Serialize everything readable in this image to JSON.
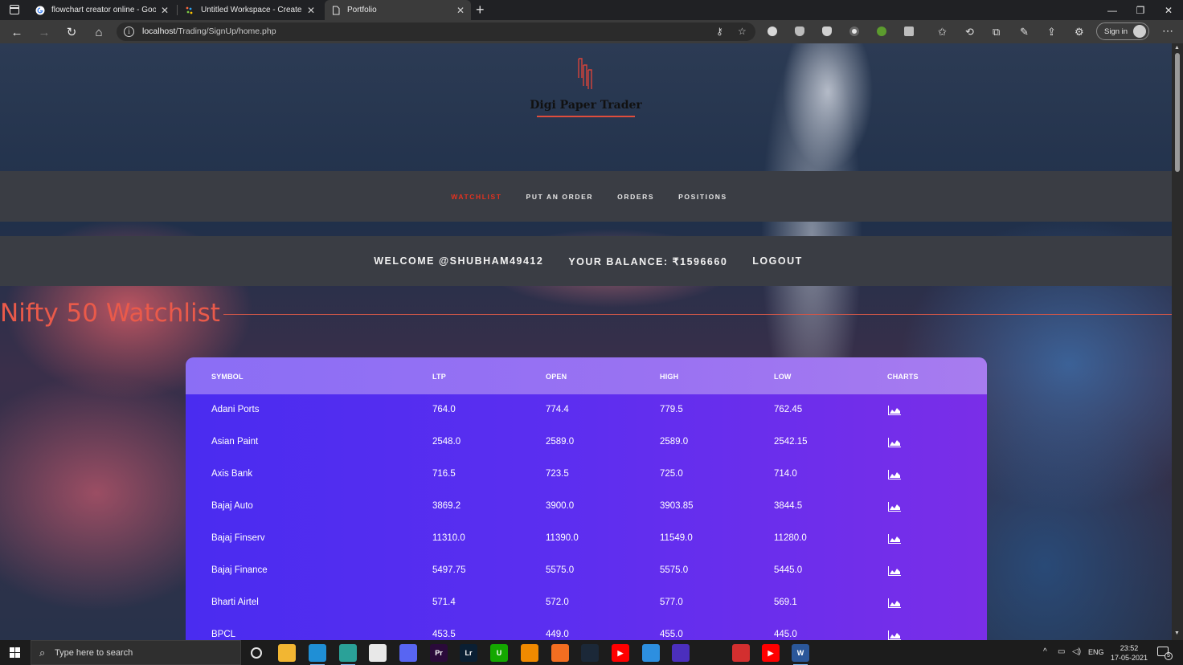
{
  "browser": {
    "tabs": [
      {
        "label": "flowchart creator online - Googl",
        "favicon": "google-icon"
      },
      {
        "label": "Untitled Workspace - Creately",
        "favicon": "creately-icon"
      },
      {
        "label": "Portfolio",
        "favicon": "page-icon",
        "active": true
      }
    ],
    "window_controls": {
      "minimize": "—",
      "maximize": "❐",
      "close": "✕"
    },
    "url_host": "localhost",
    "url_path": "/Trading/SignUp/home.php",
    "signin_label": "Sign in"
  },
  "site": {
    "brand": "Digi Paper Trader",
    "brand_color": "#e04d3c",
    "nav": {
      "watchlist": "WATCHLIST",
      "put_order": "PUT AN ORDER",
      "orders": "ORDERS",
      "positions": "POSITIONS"
    },
    "welcome": "WELCOME @SHUBHAM49412",
    "balance": "YOUR BALANCE: ₹1596660",
    "logout": "LOGOUT",
    "watchlist_title": "Nifty 50 Watchlist",
    "accent": "#ea5a4a"
  },
  "table": {
    "headers": {
      "symbol": "SYMBOL",
      "ltp": "LTP",
      "open": "OPEN",
      "high": "HIGH",
      "low": "LOW",
      "charts": "CHARTS"
    },
    "rows": [
      {
        "symbol": "Adani Ports",
        "ltp": "764.0",
        "open": "774.4",
        "high": "779.5",
        "low": "762.45"
      },
      {
        "symbol": "Asian Paint",
        "ltp": "2548.0",
        "open": "2589.0",
        "high": "2589.0",
        "low": "2542.15"
      },
      {
        "symbol": "Axis Bank",
        "ltp": "716.5",
        "open": "723.5",
        "high": "725.0",
        "low": "714.0"
      },
      {
        "symbol": "Bajaj Auto",
        "ltp": "3869.2",
        "open": "3900.0",
        "high": "3903.85",
        "low": "3844.5"
      },
      {
        "symbol": "Bajaj Finserv",
        "ltp": "11310.0",
        "open": "11390.0",
        "high": "11549.0",
        "low": "11280.0"
      },
      {
        "symbol": "Bajaj Finance",
        "ltp": "5497.75",
        "open": "5575.0",
        "high": "5575.0",
        "low": "5445.0"
      },
      {
        "symbol": "Bharti Airtel",
        "ltp": "571.4",
        "open": "572.0",
        "high": "577.0",
        "low": "569.1"
      },
      {
        "symbol": "BPCL",
        "ltp": "453.5",
        "open": "449.0",
        "high": "455.0",
        "low": "445.0"
      }
    ]
  },
  "taskbar": {
    "search_placeholder": "Type here to search",
    "language": "ENG",
    "time": "23:52",
    "date": "17-05-2021",
    "notifications": "5",
    "apps": [
      {
        "name": "cortana-icon",
        "color": "#1c1c1c",
        "glyph": "◯"
      },
      {
        "name": "file-explorer-icon",
        "color": "#f2b632",
        "glyph": ""
      },
      {
        "name": "edge-icon",
        "color": "#1f8fd6",
        "glyph": ""
      },
      {
        "name": "edge-dev-icon",
        "color": "#2aa198",
        "glyph": ""
      },
      {
        "name": "store-icon",
        "color": "#e8e8e8",
        "glyph": ""
      },
      {
        "name": "discord-icon",
        "color": "#5865f2",
        "glyph": ""
      },
      {
        "name": "premiere-icon",
        "color": "#2a0a3a",
        "glyph": "Pr"
      },
      {
        "name": "lightroom-icon",
        "color": "#0a1f33",
        "glyph": "Lr"
      },
      {
        "name": "upwork-icon",
        "color": "#14a800",
        "glyph": "U"
      },
      {
        "name": "vlc-icon",
        "color": "#f08a00",
        "glyph": ""
      },
      {
        "name": "xampp-icon",
        "color": "#f36e21",
        "glyph": ""
      },
      {
        "name": "steam-icon",
        "color": "#1b2838",
        "glyph": ""
      },
      {
        "name": "youtube-icon",
        "color": "#ff0000",
        "glyph": "▶"
      },
      {
        "name": "mail-icon",
        "color": "#2d8fe0",
        "glyph": ""
      },
      {
        "name": "amazon-music-icon",
        "color": "#4b2fbd",
        "glyph": ""
      },
      {
        "name": "prime-video-icon",
        "color": "#1c1c1c",
        "glyph": ""
      },
      {
        "name": "screen-recorder-icon",
        "color": "#d32f2f",
        "glyph": ""
      },
      {
        "name": "youtube-music-icon",
        "color": "#ff0000",
        "glyph": "▶"
      },
      {
        "name": "word-icon",
        "color": "#2b579a",
        "glyph": "W"
      }
    ]
  }
}
